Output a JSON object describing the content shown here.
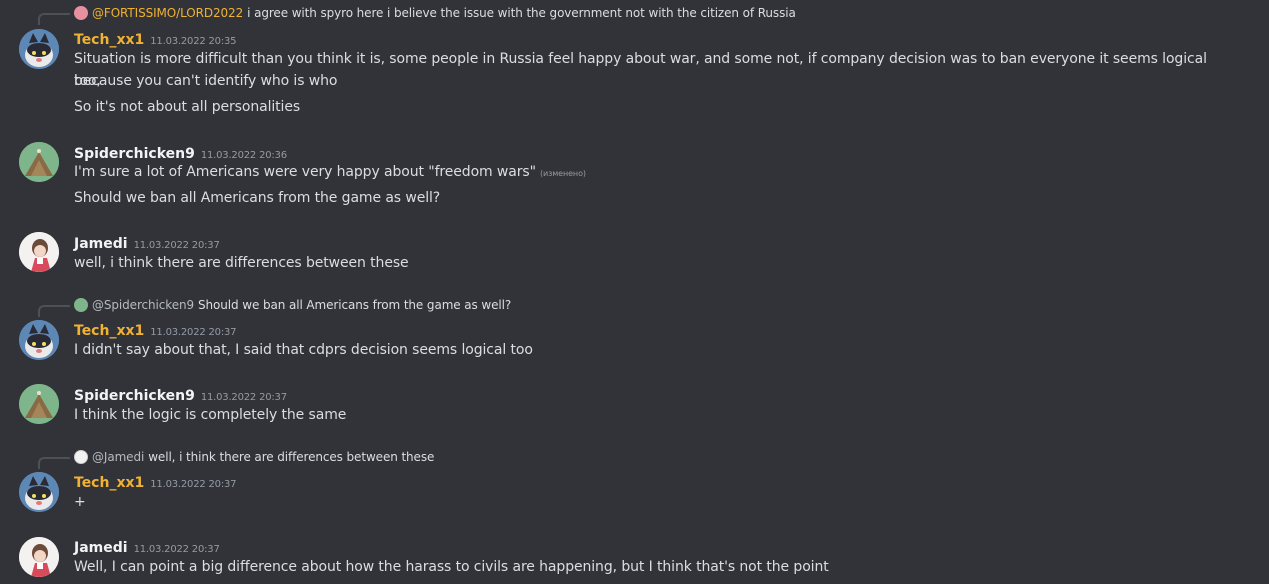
{
  "messages": [
    {
      "reply": {
        "mention": "@FORTISSIMO/LORD2022",
        "text": "i agree with spyro here   i believe the issue with the government not with the citizen of Russia"
      },
      "author": "Tech_xx1",
      "timestamp": "11.03.2022 20:35",
      "lines": [
        "Situation is more difficult than you think it is, some people in Russia feel happy about war, and some not, if company decision was to ban everyone it seems logical too,",
        "because you can't identify who is who",
        "So it's not about all personalities"
      ]
    },
    {
      "author": "Spiderchicken9",
      "timestamp": "11.03.2022 20:36",
      "lines": [
        "I'm sure a lot of Americans were very happy about \"freedom wars\"",
        "Should we ban all Americans from the game as well?"
      ],
      "edited_label": "(изменено)"
    },
    {
      "author": "Jamedi",
      "timestamp": "11.03.2022 20:37",
      "lines": [
        "well, i think there are differences between these"
      ]
    },
    {
      "reply": {
        "mention": "@Spiderchicken9",
        "text": "Should we ban all Americans from the game as well?"
      },
      "author": "Tech_xx1",
      "timestamp": "11.03.2022 20:37",
      "lines": [
        "I didn't say about that, I said that cdprs decision seems logical too"
      ]
    },
    {
      "author": "Spiderchicken9",
      "timestamp": "11.03.2022 20:37",
      "lines": [
        "I think the logic is completely the same"
      ]
    },
    {
      "reply": {
        "mention": "@Jamedi",
        "text": "well, i think there are differences between these"
      },
      "author": "Tech_xx1",
      "timestamp": "11.03.2022 20:37",
      "lines": [
        "+"
      ]
    },
    {
      "author": "Jamedi",
      "timestamp": "11.03.2022 20:37",
      "lines": [
        "Well, I can point a big difference about how the harass to civils are happening, but I think that's not the point"
      ]
    }
  ],
  "colors": {
    "background": "#313338",
    "name_highlight": "#f0b232",
    "timestamp": "#949ba4",
    "text": "#dbdee1"
  }
}
